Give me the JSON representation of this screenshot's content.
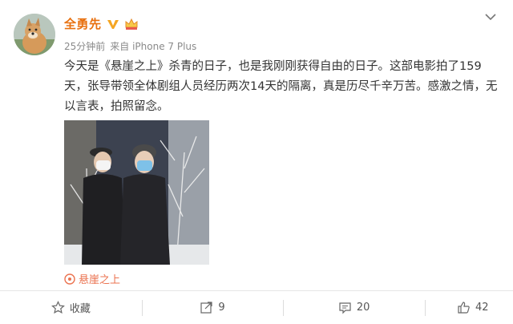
{
  "author": {
    "name": "全勇先"
  },
  "meta": {
    "time": "25分钟前",
    "source": "来自 iPhone 7 Plus"
  },
  "post": {
    "text": "今天是《悬崖之上》杀青的日子，也是我刚刚获得自由的日子。这部电影拍了159天，张导带领全体剧组人员经历两次14天的隔离，真是历尽千辛万苦。感激之情，无以言表，拍照留念。"
  },
  "topic": {
    "label": "悬崖之上"
  },
  "actions": {
    "favorite_label": "收藏",
    "repost_count": "9",
    "comment_count": "20",
    "like_count": "42"
  },
  "colors": {
    "author_name": "#e8700f",
    "topic_link": "#eb7350",
    "verified_badge": "#f5a623"
  }
}
